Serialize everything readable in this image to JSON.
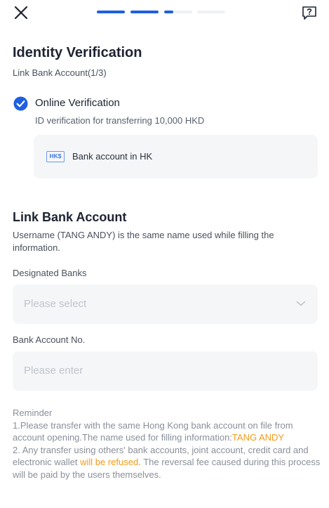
{
  "header": {
    "close_icon": "close-icon",
    "help_icon": "help-icon",
    "progress_steps": [
      {
        "status": "complete",
        "fill": 1.0
      },
      {
        "status": "complete",
        "fill": 1.0
      },
      {
        "status": "in-progress",
        "fill": 0.33
      },
      {
        "status": "pending",
        "fill": 0.0
      }
    ]
  },
  "page": {
    "title": "Identity Verification",
    "subtitle": "Link Bank Account(1/3)"
  },
  "option": {
    "title": "Online Verification",
    "description": "ID verification for transferring 10,000 HKD",
    "checked": true,
    "bank_card": {
      "icon_text": "HK$",
      "label": "Bank account in HK"
    }
  },
  "link_bank": {
    "title": "Link Bank Account",
    "description": "Username (TANG ANDY) is the same name used while filling the information.",
    "designated_banks": {
      "label": "Designated Banks",
      "placeholder": "Please select"
    },
    "account_no": {
      "label": "Bank Account No.",
      "placeholder": "Please enter"
    }
  },
  "reminder": {
    "heading": "Reminder",
    "line1_prefix": "1.Please transfer with the same Hong Kong bank account on file from account opening.The name used for filling information:",
    "line1_name": "TANG ANDY",
    "line2_prefix": "2. Any transfer using others' bank accounts, joint account, credit card and electronic wallet ",
    "line2_highlight": "will be refused",
    "line2_suffix": ". The reversal fee caused during this process will be paid by the users themselves."
  },
  "colors": {
    "accent": "#1f5fe0",
    "warning": "#f29a1a",
    "field_bg": "#f5f6f8"
  }
}
